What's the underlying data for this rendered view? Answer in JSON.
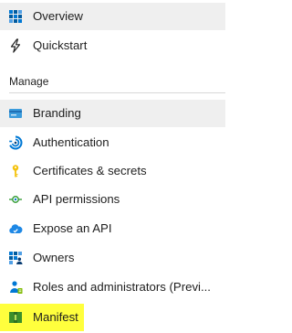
{
  "nav": {
    "top_items": [
      {
        "label": "Overview",
        "icon": "overview-grid-icon",
        "active": true
      },
      {
        "label": "Quickstart",
        "icon": "quickstart-bolt-icon",
        "active": false
      }
    ],
    "section_title": "Manage",
    "manage_items": [
      {
        "label": "Branding",
        "icon": "branding-card-icon",
        "active": true
      },
      {
        "label": "Authentication",
        "icon": "authentication-icon",
        "active": false
      },
      {
        "label": "Certificates & secrets",
        "icon": "key-icon",
        "active": false
      },
      {
        "label": "API permissions",
        "icon": "api-permissions-icon",
        "active": false
      },
      {
        "label": "Expose an API",
        "icon": "cloud-icon",
        "active": false
      },
      {
        "label": "Owners",
        "icon": "owners-grid-icon",
        "active": false
      },
      {
        "label": "Roles and administrators (Previ...",
        "icon": "user-roles-icon",
        "active": false
      },
      {
        "label": "Manifest",
        "icon": "manifest-icon",
        "active": false,
        "highlighted": true
      }
    ]
  },
  "colors": {
    "active_background": "#efefef",
    "highlight": "#ffff3d",
    "azure_blue": "#0078d4",
    "key_yellow": "#f4c20d",
    "api_green": "#3b9f3b",
    "manifest_green": "#3c8f2b"
  }
}
